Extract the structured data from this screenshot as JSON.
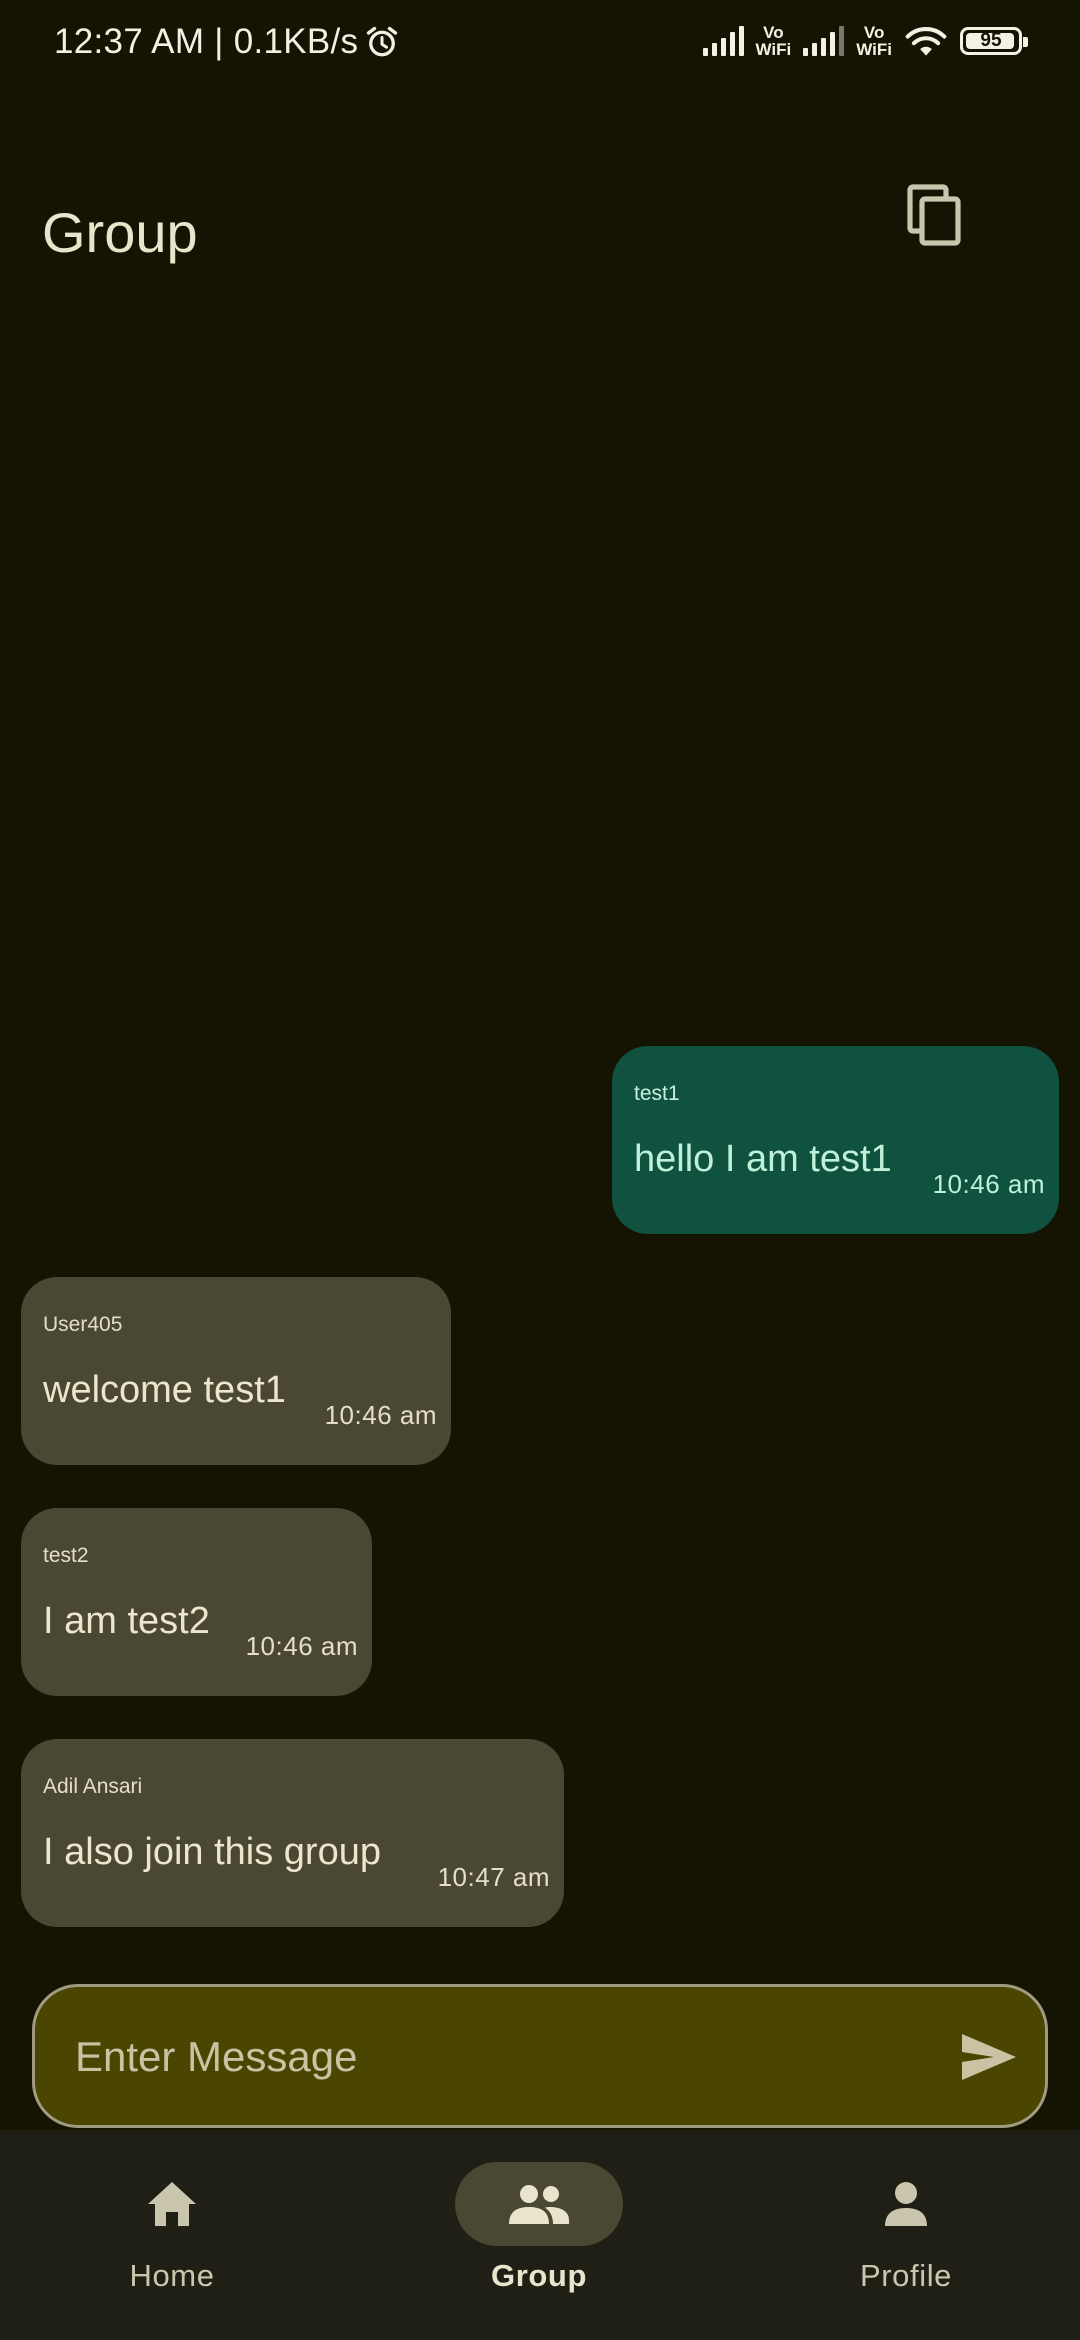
{
  "status_bar": {
    "time": "12:37 AM",
    "separator": "|",
    "net_speed": "0.1KB/s",
    "vowifi_1": "Vo",
    "wifi_1": "WiFi",
    "vowifi_2": "Vo",
    "wifi_2": "WiFi",
    "battery_level": "95",
    "battery_fraction": 0.95
  },
  "header": {
    "title": "Group",
    "action_icon": "copy-icon"
  },
  "messages": [
    {
      "sender": "test1",
      "text": "hello I am test1",
      "time": "10:46 am",
      "own": true
    },
    {
      "sender": "User405",
      "text": "welcome test1",
      "time": "10:46 am",
      "own": false
    },
    {
      "sender": "test2",
      "text": "I am test2",
      "time": "10:46 am",
      "own": false
    },
    {
      "sender": "Adil Ansari",
      "text": "I also join this group",
      "time": "10:47 am",
      "own": false
    }
  ],
  "composer": {
    "placeholder": "Enter Message",
    "value": "",
    "send_icon": "send-icon"
  },
  "bottom_nav": {
    "items": [
      {
        "label": "Home",
        "icon": "home-icon",
        "active": false
      },
      {
        "label": "Group",
        "icon": "group-icon",
        "active": true
      },
      {
        "label": "Profile",
        "icon": "profile-icon",
        "active": false
      }
    ]
  },
  "colors": {
    "background": "#151403",
    "bubble_other": "#4a4832",
    "bubble_self": "#0f5240",
    "composer_bg": "#4a4500",
    "nav_bg": "#201f15"
  }
}
